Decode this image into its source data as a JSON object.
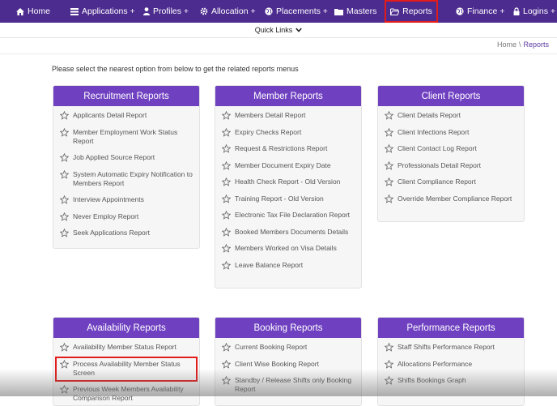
{
  "nav": {
    "items": [
      {
        "label": "Home",
        "icon": "home-icon"
      },
      {
        "label": "Applications +",
        "icon": "list-icon"
      },
      {
        "label": "Profiles +",
        "icon": "user-icon"
      },
      {
        "label": "Allocation +",
        "icon": "gear-icon"
      },
      {
        "label": "Placements +",
        "icon": "globe-icon"
      },
      {
        "label": "Masters",
        "icon": "folder-icon"
      },
      {
        "label": "Reports",
        "icon": "folder-open-icon"
      },
      {
        "label": "Finance +",
        "icon": "globe-icon"
      },
      {
        "label": "Logins +",
        "icon": "lock-icon"
      }
    ]
  },
  "quick_links": {
    "label": "Quick Links"
  },
  "breadcrumb": {
    "home": "Home",
    "separator": "\\",
    "current": "Reports"
  },
  "instruction": "Please select the nearest option from below to get the related reports menus",
  "cards": {
    "recruitment": {
      "title": "Recruitment Reports",
      "items": [
        "Applicants Detail Report",
        "Member Employment Work Status Report",
        "Job Applied Source Report",
        "System Automatic Expiry Notification to Members Report",
        "Interview Appointments",
        "Never Employ Report",
        "Seek Applications Report"
      ]
    },
    "member": {
      "title": "Member Reports",
      "items": [
        "Members Detail Report",
        "Expiry Checks Report",
        "Request & Restrictions Report",
        "Member Document Expiry Date",
        "Health Check Report - Old Version",
        "Training Report - Old Version",
        "Electronic Tax File Declaration Report",
        "Booked Members Documents Details",
        "Members Worked on Visa Details",
        "Leave Balance Report"
      ]
    },
    "client": {
      "title": "Client Reports",
      "items": [
        "Client Details Report",
        "Client Infections Report",
        "Client Contact Log Report",
        "Professionals Detail Report",
        "Client Compliance Report",
        "Override Member Compliance Report"
      ]
    },
    "availability": {
      "title": "Availability Reports",
      "items": [
        "Availability Member Status Report",
        "Process Availability Member Status Screen",
        "Previous Week Members Availability Comparison Report"
      ]
    },
    "booking": {
      "title": "Booking Reports",
      "items": [
        "Current Booking Report",
        "Client Wise Booking Report",
        "Standby / Release Shifts only Booking Report"
      ]
    },
    "performance": {
      "title": "Performance Reports",
      "items": [
        "Staff Shifts Performance Report",
        "Allocations Performance",
        "Shifts Bookings Graph"
      ]
    }
  },
  "colors": {
    "nav_bg": "#4d2c8f",
    "card_header": "#6f41c1",
    "highlight": "#e21b1b"
  }
}
